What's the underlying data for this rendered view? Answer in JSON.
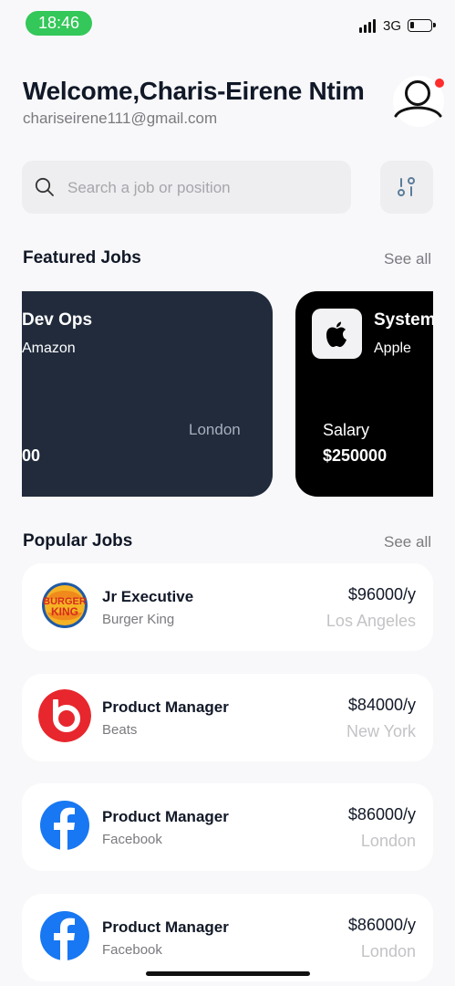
{
  "status_bar": {
    "time": "18:46",
    "network": "3G"
  },
  "header": {
    "welcome": "Welcome,Charis-Eirene Ntim",
    "email": "chariseirene111@gmail.com"
  },
  "search": {
    "placeholder": "Search a job or position"
  },
  "featured": {
    "title": "Featured Jobs",
    "see_all": "See all",
    "cards": [
      {
        "title": "Dev Ops",
        "company": "Amazon",
        "location": "London",
        "salary_value": "00",
        "theme": "#212b3c"
      },
      {
        "title": "System",
        "company": "Apple",
        "logo": "apple-icon",
        "salary_label": "Salary",
        "salary_value": "$250000",
        "theme": "#000000"
      }
    ]
  },
  "popular": {
    "title": "Popular Jobs",
    "see_all": "See all",
    "jobs": [
      {
        "title": "Jr Executive",
        "company": "Burger King",
        "salary": "$96000/y",
        "location": "Los Angeles",
        "logo": "burger-king-logo"
      },
      {
        "title": "Product Manager",
        "company": "Beats",
        "salary": "$84000/y",
        "location": "New York",
        "logo": "beats-logo"
      },
      {
        "title": "Product Manager",
        "company": "Facebook",
        "salary": "$86000/y",
        "location": "London",
        "logo": "facebook-logo"
      },
      {
        "title": "Product Manager",
        "company": "Facebook",
        "salary": "$86000/y",
        "location": "London",
        "logo": "facebook-logo"
      }
    ]
  },
  "colors": {
    "status_green": "#34c759",
    "notification_red": "#ff2d2d",
    "card_dark": "#212b3c",
    "card_black": "#000000",
    "facebook_blue": "#1877f2",
    "beats_red": "#e7272d"
  }
}
